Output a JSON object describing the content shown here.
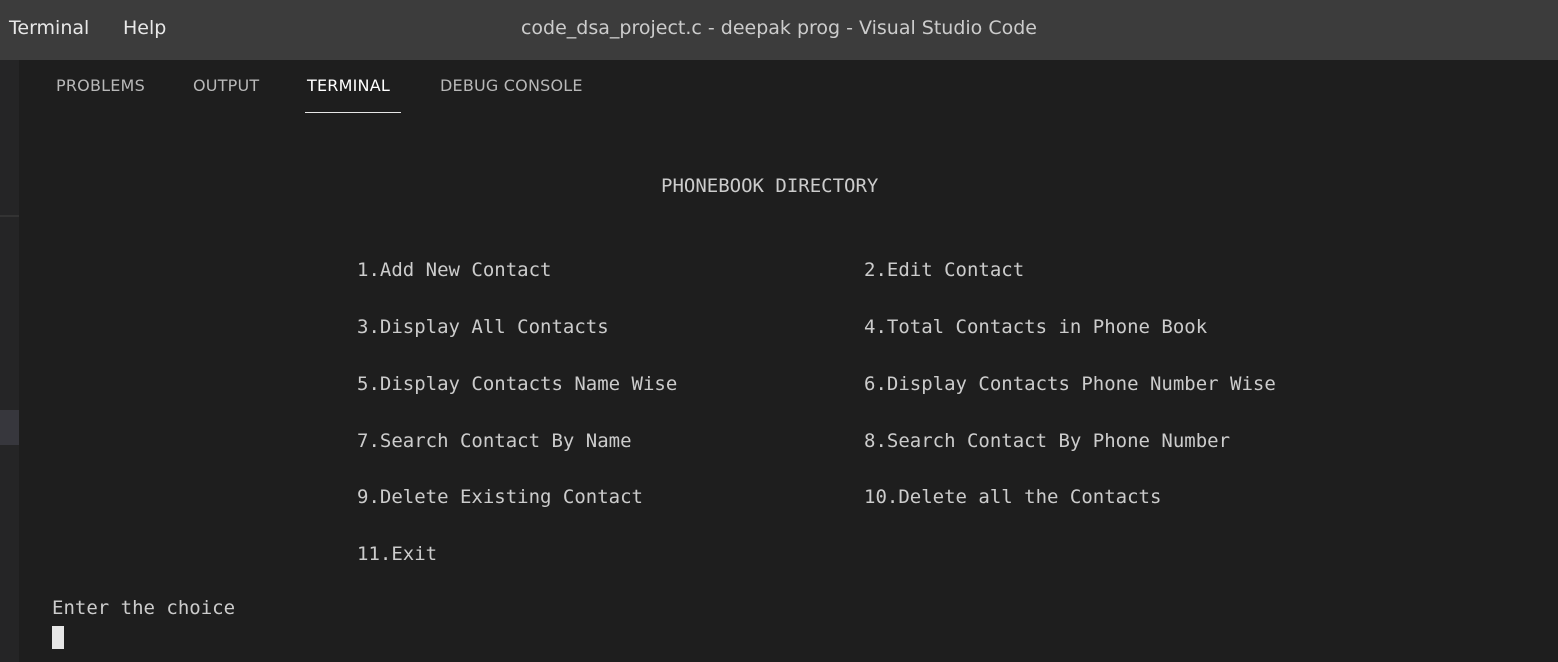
{
  "window": {
    "title": "code_dsa_project.c - deepak prog - Visual Studio Code",
    "menu": [
      "Terminal",
      "Help"
    ]
  },
  "panel": {
    "tabs": [
      {
        "label": "PROBLEMS",
        "active": false
      },
      {
        "label": "OUTPUT",
        "active": false
      },
      {
        "label": "TERMINAL",
        "active": true
      },
      {
        "label": "DEBUG CONSOLE",
        "active": false
      }
    ]
  },
  "terminal": {
    "heading": "PHONEBOOK DIRECTORY",
    "options": [
      "1.Add New Contact",
      "2.Edit Contact",
      "3.Display All Contacts",
      "4.Total Contacts in Phone Book",
      "5.Display Contacts Name Wise",
      "6.Display Contacts Phone Number Wise",
      "7.Search Contact By Name",
      "8.Search Contact By Phone Number",
      "9.Delete Existing Contact",
      "10.Delete all the Contacts",
      "11.Exit"
    ],
    "prompt": "Enter the choice"
  },
  "colors": {
    "background": "#1e1e1e",
    "titlebar": "#3c3c3c",
    "text": "#cccccc"
  }
}
